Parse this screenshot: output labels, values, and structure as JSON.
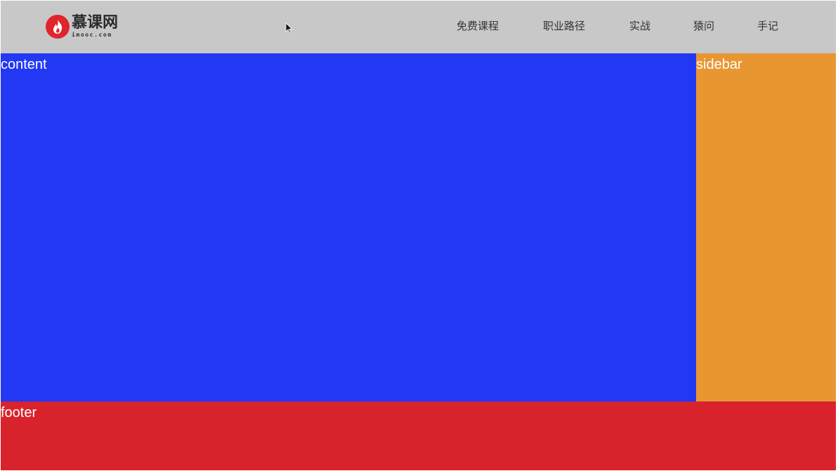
{
  "header": {
    "logo": {
      "name_cn": "慕课网",
      "name_en": "imooc.com"
    },
    "nav": [
      {
        "label": "免费课程"
      },
      {
        "label": "职业路径"
      },
      {
        "label": "实战"
      },
      {
        "label": "猿问"
      },
      {
        "label": "手记"
      }
    ]
  },
  "content": {
    "label": "content"
  },
  "sidebar": {
    "label": "sidebar"
  },
  "footer": {
    "label": "footer"
  },
  "colors": {
    "header_bg": "#c8c8c8",
    "content_bg": "#2338f4",
    "sidebar_bg": "#e89631",
    "footer_bg": "#d8232d",
    "logo_red": "#e0252d"
  }
}
